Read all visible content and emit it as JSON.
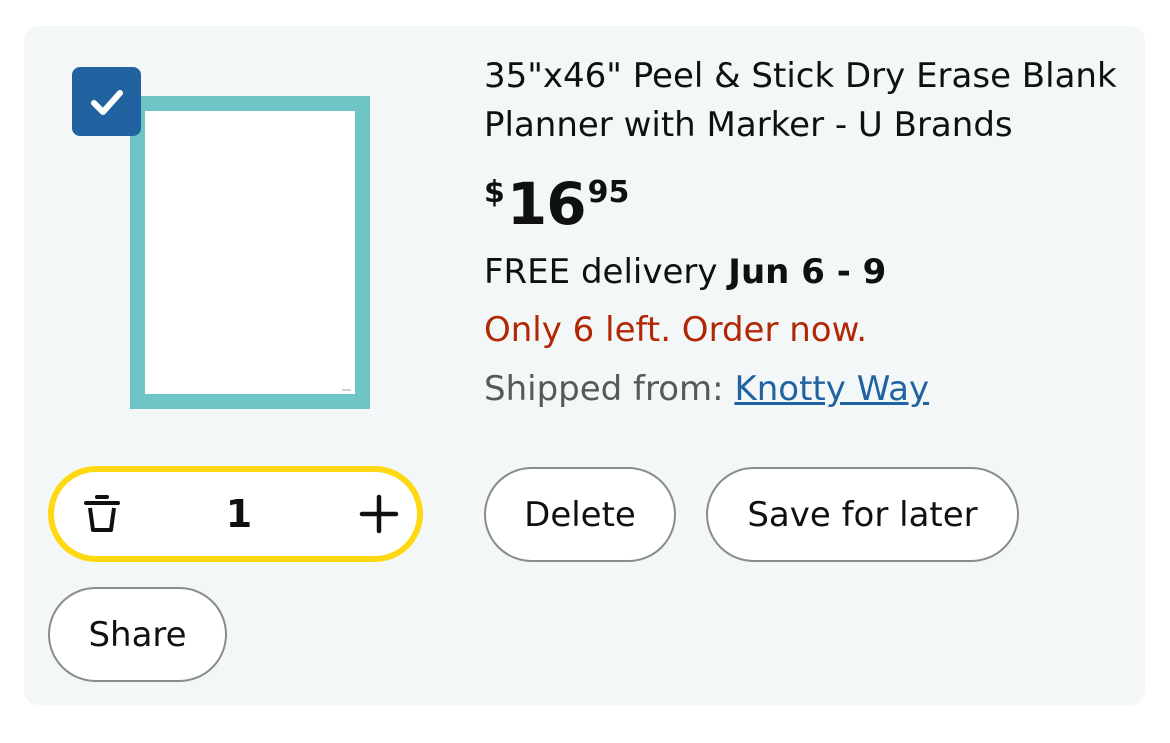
{
  "item": {
    "title": "35\"x46\" Peel & Stick Dry Erase Blank Planner with Marker - U Brands",
    "price": {
      "symbol": "$",
      "whole": "16",
      "fraction": "95"
    },
    "delivery": {
      "prefix": "FREE delivery",
      "dates": "Jun 6 - 9"
    },
    "stock_message": "Only 6 left. Order now.",
    "shipped": {
      "label": "Shipped from:",
      "seller": "Knotty Way"
    },
    "selected": true,
    "quantity": "1",
    "actions": {
      "delete_label": "Delete",
      "save_label": "Save for later",
      "share_label": "Share"
    }
  },
  "colors": {
    "card_background": "#f4f7f8",
    "checkbox": "#2162a1",
    "quantity_border": "#ffd814",
    "stock_text": "#b12704",
    "link": "#2162a1",
    "thumbnail_frame": "#6fc4c5"
  },
  "icons": {
    "checkbox": "checkmark-icon",
    "quantity_decrease": "trash-icon",
    "quantity_increase": "plus-icon"
  }
}
